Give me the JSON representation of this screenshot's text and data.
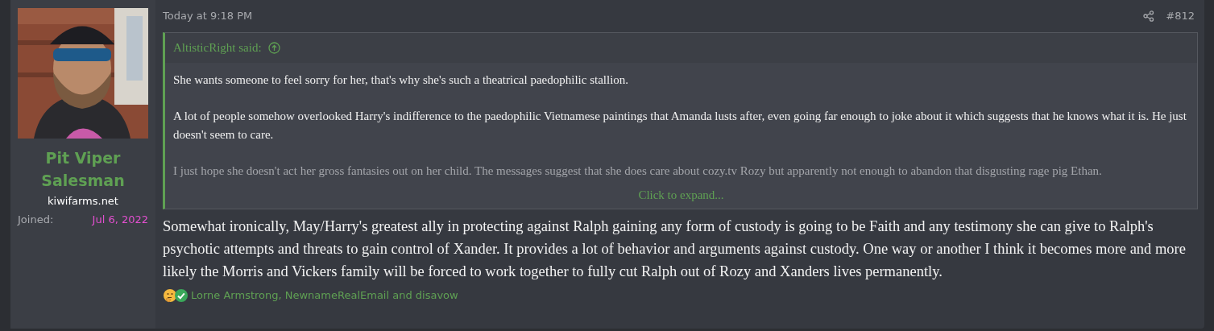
{
  "user": {
    "name": "Pit Viper Salesman",
    "title": "kiwifarms.net",
    "joined_label": "Joined:",
    "joined_date": "Jul 6, 2022"
  },
  "post": {
    "time": "Today at 9:18 PM",
    "number": "#812",
    "quote": {
      "author": "AltisticRight said:",
      "paragraphs": [
        {
          "text": "She wants someone to feel sorry for her, that's why she's such a theatrical paedophilic stallion.",
          "faded": false
        },
        {
          "text": "A lot of people somehow overlooked Harry's indifference to the paedophilic Vietnamese paintings that Amanda lusts after, even going far enough to joke about it which suggests that he knows what it is. He just doesn't seem to care.",
          "faded": false
        },
        {
          "text": "I just hope she doesn't act her gross fantasies out on her child. The messages suggest that she does care about cozy.tv Rozy but apparently not enough to abandon that disgusting rage pig Ethan.",
          "faded": true
        }
      ],
      "expand": "Click to expand..."
    },
    "body": "Somewhat ironically, May/Harry's greatest ally in protecting against Ralph gaining any form of custody is going to be Faith and any testimony she can give to Ralph's psychotic attempts and threats to gain control of Xander. It provides a lot of behavior and arguments against custody. One way or another I think it becomes more and more likely the Morris and Vickers family will be forced to work together to fully cut Ralph out of Rozy and Xanders lives permanently.",
    "reactions": [
      {
        "kind": "thinking"
      },
      {
        "kind": "check"
      }
    ],
    "reacted_by": "Lorne Armstrong, NewnameRealEmail and disavow"
  }
}
